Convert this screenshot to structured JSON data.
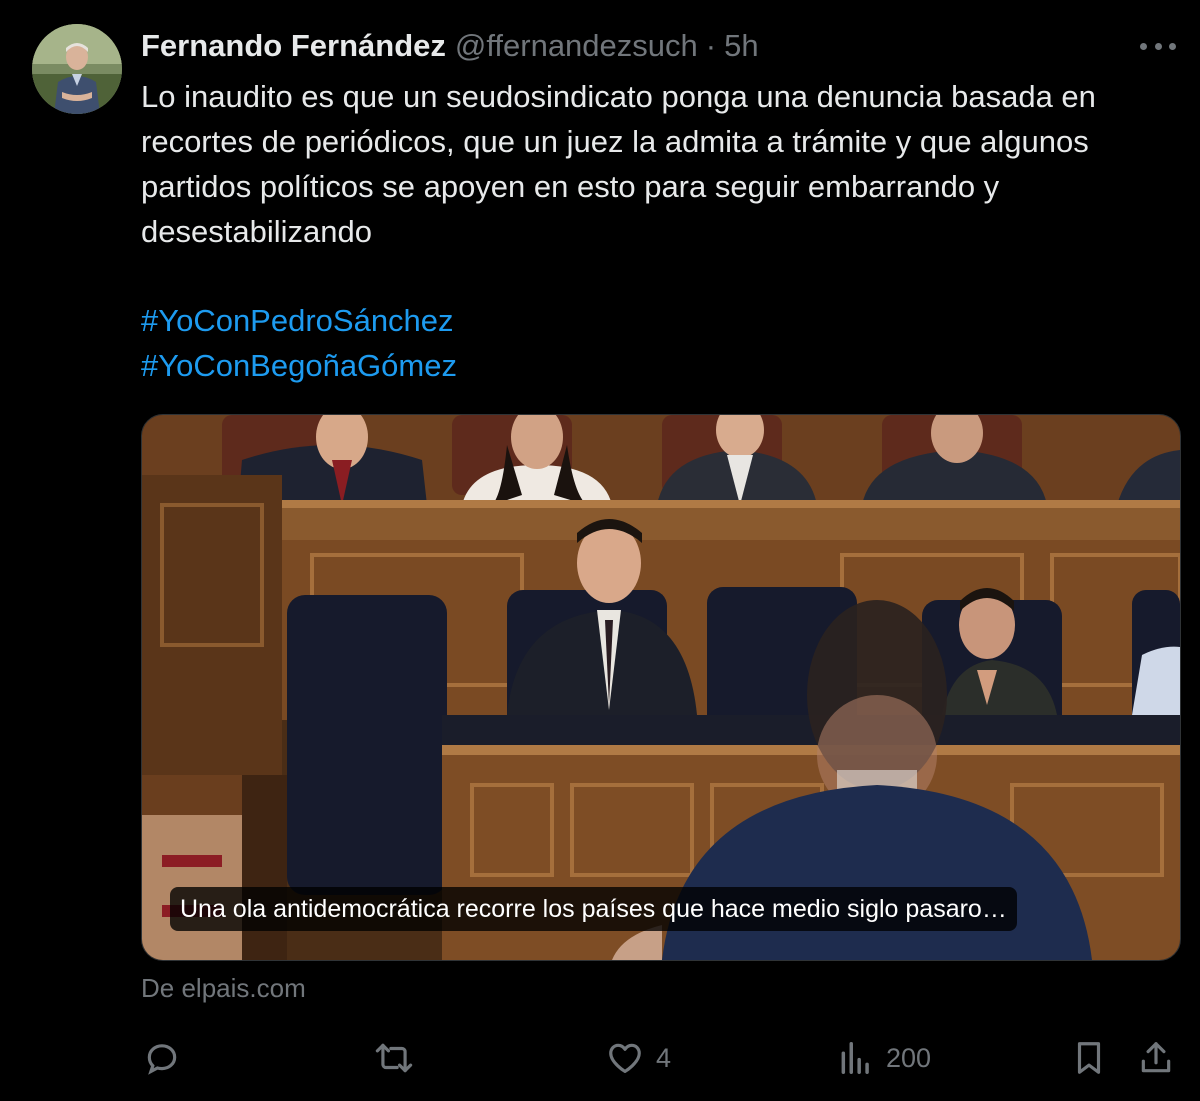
{
  "author": {
    "name": "Fernando Fernández",
    "handle": "@ffernandezsuch",
    "separator": "·",
    "time": "5h"
  },
  "tweet": {
    "text": "Lo inaudito es que un seudosindicato ponga una denuncia basada en recortes de periódicos, que un juez la admita a trámite y que algunos partidos políticos se apoyen en esto para seguir embarrando y desestabilizando",
    "hashtags": [
      "#YoConPedroSánchez",
      "#YoConBegoñaGómez"
    ]
  },
  "card": {
    "caption": "Una ola antidemocrática recorre los países que hace medio siglo pasaro…",
    "source": "De elpais.com"
  },
  "actions": {
    "reply_count": "",
    "retweet_count": "",
    "like_count": "4",
    "views_count": "200"
  },
  "colors": {
    "background": "#000000",
    "text": "#e7e9ea",
    "muted": "#71767b",
    "link": "#1d9bf0",
    "border": "#2f3336"
  },
  "icons": [
    "more-icon",
    "reply-icon",
    "retweet-icon",
    "like-icon",
    "views-icon",
    "bookmark-icon",
    "share-icon"
  ]
}
